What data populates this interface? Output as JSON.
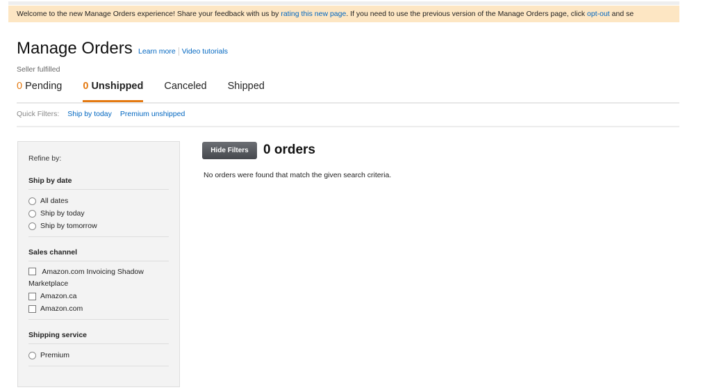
{
  "banner": {
    "text_1": "Welcome to the new Manage Orders experience! Share your feedback with us by ",
    "link_1": "rating this new page",
    "text_2": ". If you need to use the previous version of the Manage Orders page, click ",
    "link_2": "opt-out",
    "text_3": " and se"
  },
  "header": {
    "title": "Manage Orders",
    "learn_more": "Learn more",
    "video_tutorials": "Video tutorials",
    "subtitle": "Seller fulfilled"
  },
  "tabs": [
    {
      "count": "0",
      "label": "Pending",
      "active": false
    },
    {
      "count": "0",
      "label": "Unshipped",
      "active": true
    },
    {
      "count": "",
      "label": "Canceled",
      "active": false
    },
    {
      "count": "",
      "label": "Shipped",
      "active": false
    }
  ],
  "quick_filters": {
    "label": "Quick Filters:",
    "items": [
      "Ship by today",
      "Premium unshipped"
    ]
  },
  "sidebar": {
    "refine": "Refine by:",
    "ship_by_date": {
      "title": "Ship by date",
      "options": [
        "All dates",
        "Ship by today",
        "Ship by tomorrow"
      ]
    },
    "sales_channel": {
      "title": "Sales channel",
      "options": [
        "Amazon.com Invoicing Shadow Marketplace",
        "Amazon.ca",
        "Amazon.com"
      ]
    },
    "shipping_service": {
      "title": "Shipping service",
      "options": [
        "Premium"
      ]
    }
  },
  "main": {
    "hide_filters": "Hide Filters",
    "orders_count": "0 orders",
    "empty_message": "No orders were found that match the given search criteria."
  },
  "colors": {
    "accent": "#e47911",
    "link": "#0066c0",
    "banner_bg": "#fde6c3"
  }
}
